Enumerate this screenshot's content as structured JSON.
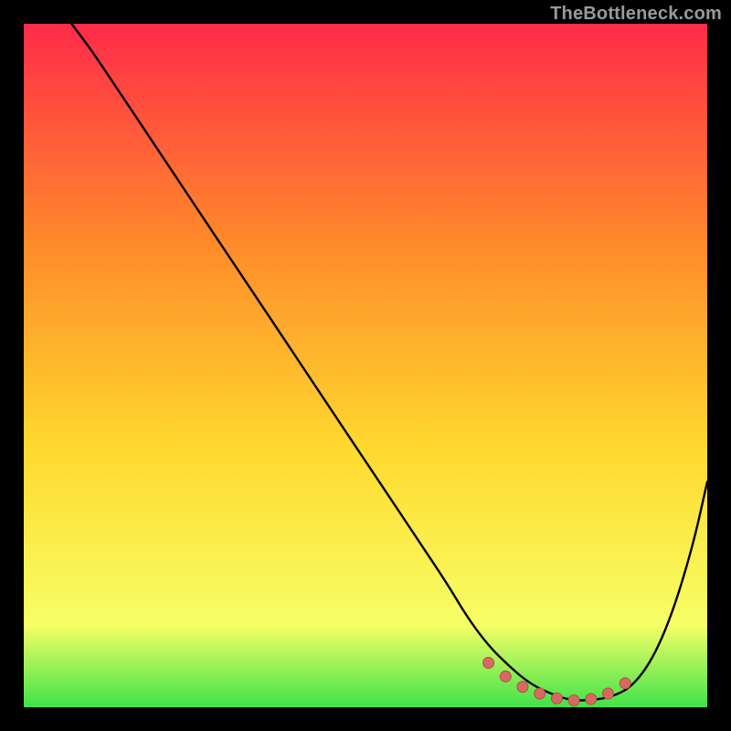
{
  "watermark": "TheBottleneck.com",
  "colors": {
    "frame_bg": "#000000",
    "curve": "#000000",
    "dot_fill": "#d66a63",
    "dot_stroke": "#b84c45",
    "grad_top": "#ff2b4a",
    "grad_mid1": "#ff8a2a",
    "grad_mid2": "#ffd92e",
    "grad_low": "#f6ff66",
    "grad_bottom": "#3fe24a"
  },
  "chart_data": {
    "type": "line",
    "title": "",
    "xlabel": "",
    "ylabel": "",
    "xlim": [
      0,
      100
    ],
    "ylim": [
      0,
      100
    ],
    "legend": false,
    "grid": false,
    "series": [
      {
        "name": "bottleneck-curve",
        "x": [
          7,
          10,
          14,
          18,
          22,
          26,
          30,
          34,
          38,
          42,
          46,
          50,
          54,
          58,
          62,
          65,
          68,
          71,
          74,
          77,
          80,
          83,
          86,
          89,
          92,
          95,
          98,
          100
        ],
        "y": [
          100,
          96,
          90,
          84,
          78,
          72,
          66,
          60,
          54,
          48,
          42,
          36,
          30,
          24,
          18,
          13,
          9,
          6,
          3.5,
          2,
          1,
          1,
          1.5,
          3,
          7,
          14,
          24,
          33
        ]
      }
    ],
    "dots": {
      "name": "highlight-dots",
      "x": [
        68,
        70.5,
        73,
        75.5,
        78,
        80.5,
        83,
        85.5,
        88
      ],
      "y": [
        6.5,
        4.5,
        3,
        2,
        1.3,
        1,
        1.2,
        2,
        3.5
      ]
    }
  }
}
